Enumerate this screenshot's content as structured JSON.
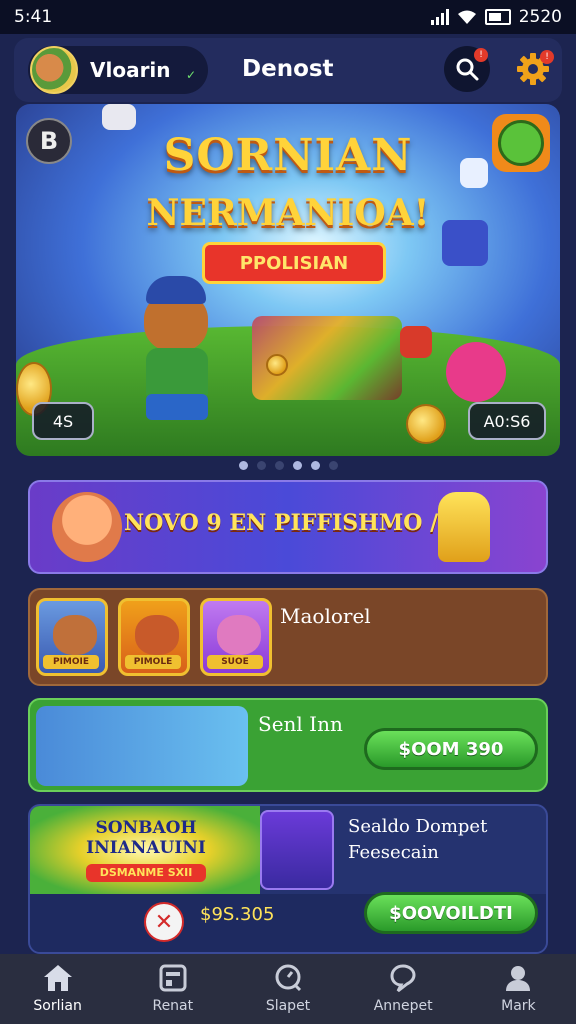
{
  "status_bar": {
    "time": "5:41",
    "clock_right": "2520"
  },
  "header": {
    "username": "Vloarin",
    "title": "Denost",
    "search_badge": "!",
    "settings_badge": "!"
  },
  "hero": {
    "badge_letter": "B",
    "title_line1": "SORNIAN",
    "title_line2": "NERMANIOA!",
    "pill_label": "PPOLISIAN",
    "counter_left": "4S",
    "counter_right": "A0:S6"
  },
  "carousel": {
    "total": 6,
    "active": [
      4,
      5
    ]
  },
  "promo": {
    "text": "NOVO 9 EN PIFFISHMO /"
  },
  "cards": {
    "brown": {
      "title": "Maolorel",
      "thumbs": [
        "PIMOIE",
        "PIMOLE",
        "SUOE"
      ]
    },
    "green": {
      "title": "Senl Inn",
      "button": "$OOM 390"
    },
    "blue": {
      "banner_text": "SONBAOH INIANAUINI",
      "banner_pill": "DSMANME SXII",
      "title_line1": "Sealdo Dompet",
      "title_line2": "Feesecain",
      "price": "$9S.305",
      "button": "$OOVOILDTI"
    }
  },
  "nav": [
    {
      "label": "Sorlian",
      "icon": "home-icon",
      "active": true
    },
    {
      "label": "Renat",
      "icon": "store-icon",
      "active": false
    },
    {
      "label": "Slapet",
      "icon": "search-icon",
      "active": false
    },
    {
      "label": "Annepet",
      "icon": "chat-icon",
      "active": false
    },
    {
      "label": "Mark",
      "icon": "profile-icon",
      "active": false
    }
  ],
  "colors": {
    "background": "#1c2450",
    "accent_gold": "#ffd33a",
    "button_green": "#3aa234",
    "badge_red": "#e23a2a"
  }
}
